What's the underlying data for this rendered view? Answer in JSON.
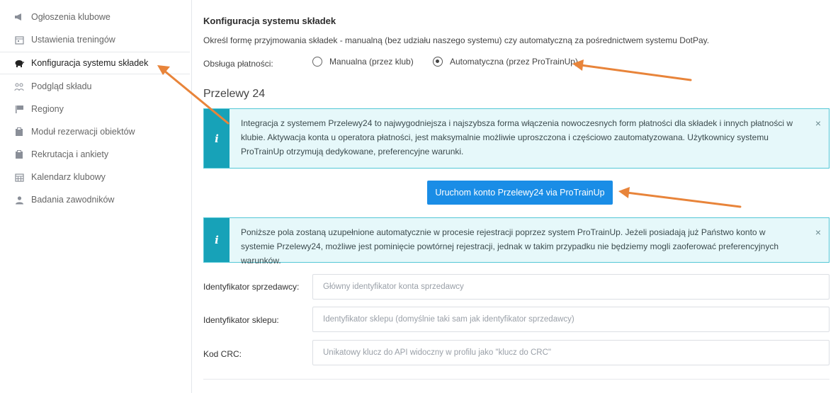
{
  "sidebar": {
    "items": [
      {
        "label": "Ogłoszenia klubowe",
        "icon": "megaphone-icon"
      },
      {
        "label": "Ustawienia treningów",
        "icon": "calendar-icon"
      },
      {
        "label": "Konfiguracja systemu składek",
        "icon": "piggy-bank-icon",
        "active": true
      },
      {
        "label": "Podgląd składu",
        "icon": "users-icon"
      },
      {
        "label": "Regiony",
        "icon": "flag-icon"
      },
      {
        "label": "Moduł rezerwacji obiektów",
        "icon": "clipboard-icon"
      },
      {
        "label": "Rekrutacja i ankiety",
        "icon": "clipboard-icon"
      },
      {
        "label": "Kalendarz klubowy",
        "icon": "calendar-grid-icon"
      },
      {
        "label": "Badania zawodników",
        "icon": "user-icon"
      }
    ]
  },
  "main": {
    "title": "Konfiguracja systemu składek",
    "description": "Określ formę przyjmowania składek - manualną (bez udziału naszego systemu) czy automatyczną za pośrednictwem systemu DotPay.",
    "payment_label": "Obsługa płatności:",
    "radio_manual": "Manualna (przez klub)",
    "radio_auto": "Automatyczna (przez ProTrainUp)",
    "selected": "auto",
    "section_title": "Przelewy 24",
    "alert1": "Integracja z systemem Przelewy24 to najwygodniejsza i najszybsza forma włączenia nowoczesnych form płatności dla składek i innych płatności w klubie. Aktywacja konta u operatora płatności, jest maksymalnie możliwie uproszczona i częściowo zautomatyzowana. Użytkownicy systemu ProTrainUp otrzymują dedykowane, preferencyjne warunki.",
    "button_label": "Uruchom konto Przelewy24 via ProTrainUp",
    "alert2": "Poniższe pola zostaną uzupełnione automatycznie w procesie rejestracji poprzez system ProTrainUp. Jeżeli posiadają już Państwo konto w systemie Przelewy24, możliwe jest pominięcie powtórnej rejestracji, jednak w takim przypadku nie będziemy mogli zaoferować preferencyjnych warunków.",
    "alert_icon": "i",
    "close_glyph": "×",
    "fields": [
      {
        "label": "Identyfikator sprzedawcy:",
        "placeholder": "Główny identyfikator konta sprzedawcy"
      },
      {
        "label": "Identyfikator sklepu:",
        "placeholder": "Identyfikator sklepu (domyślnie taki sam jak identyfikator sprzedawcy)"
      },
      {
        "label": "Kod CRC:",
        "placeholder": "Unikatowy klucz do API widoczny w profilu jako \"klucz do CRC\""
      }
    ]
  },
  "colors": {
    "accent": "#1a8de6",
    "info": "#17a2b8",
    "info_bg": "#e6f8fa",
    "annotation_arrow": "#e8843a"
  }
}
